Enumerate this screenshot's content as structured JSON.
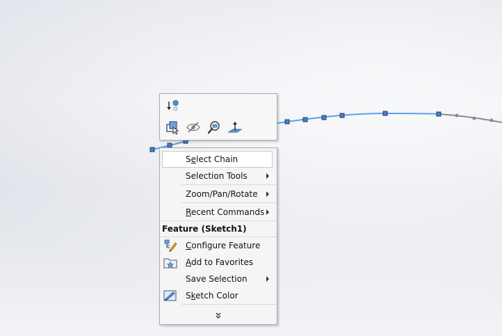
{
  "toolbar": {
    "icons": [
      "flip-dimension-icon",
      "view-orientation-icon",
      "hide-show-icon",
      "zoom-to-selection-icon",
      "normal-to-icon"
    ]
  },
  "menu": {
    "items_top": [
      {
        "label": "Select Chain",
        "mnemonic": "e",
        "has_submenu": false,
        "highlighted": true
      },
      {
        "label": "Selection Tools",
        "mnemonic": "",
        "has_submenu": true
      },
      {
        "label": "Zoom/Pan/Rotate",
        "mnemonic": "",
        "has_submenu": true
      },
      {
        "label": "Recent Commands",
        "mnemonic": "R",
        "has_submenu": true
      }
    ],
    "section_header": "Feature (Sketch1)",
    "items_feature": [
      {
        "label": "Configure Feature",
        "mnemonic": "C",
        "has_submenu": false,
        "icon": "configure-feature-icon"
      },
      {
        "label": "Add to Favorites",
        "mnemonic": "A",
        "has_submenu": false,
        "icon": "add-to-favorites-icon"
      },
      {
        "label": "Save Selection",
        "mnemonic": "",
        "has_submenu": true
      },
      {
        "label": "Sketch Color",
        "mnemonic": "k",
        "has_submenu": false,
        "icon": "sketch-color-icon"
      }
    ],
    "more_icon": "expand-menu-chevron-icon"
  },
  "colors": {
    "spline_selected": "#5b9fea",
    "spline_unselected": "#8a8a8a",
    "point_fill": "#4b7fc4",
    "menu_bg": "#f5f5f5"
  }
}
